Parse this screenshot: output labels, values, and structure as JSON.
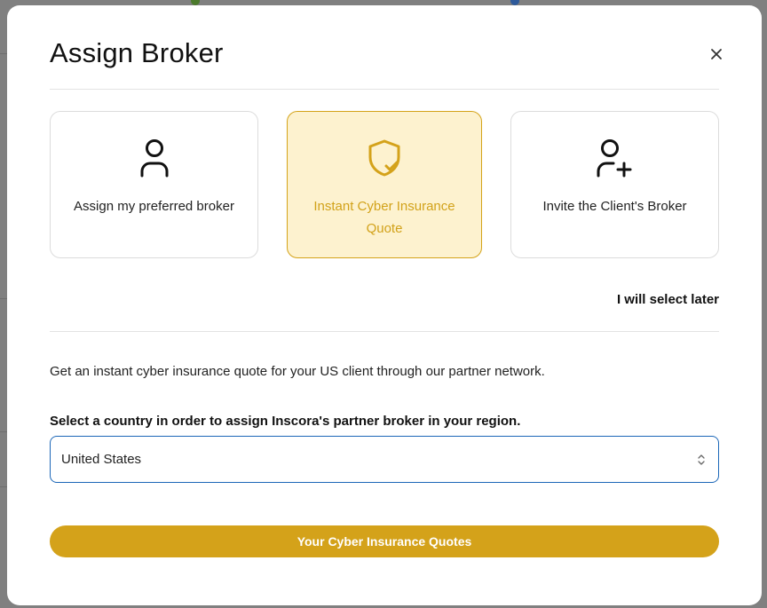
{
  "modal": {
    "title": "Assign Broker",
    "close_icon": "close-icon"
  },
  "options": [
    {
      "label": "Assign my preferred broker",
      "icon": "user-icon",
      "selected": false
    },
    {
      "label": "Instant Cyber Insurance Quote",
      "icon": "shield-check-icon",
      "selected": true
    },
    {
      "label": "Invite the Client's Broker",
      "icon": "user-plus-icon",
      "selected": false
    }
  ],
  "select_later_label": "I will select later",
  "description": "Get an instant cyber insurance quote for your US client through our partner network.",
  "country_field": {
    "label": "Select a country in order to assign Inscora's partner broker in your region.",
    "value": "United States"
  },
  "submit_button_label": "Your Cyber Insurance Quotes",
  "colors": {
    "accent": "#d4a21a",
    "selected_card_bg": "#fdf2cf",
    "select_border": "#1c67b8"
  }
}
